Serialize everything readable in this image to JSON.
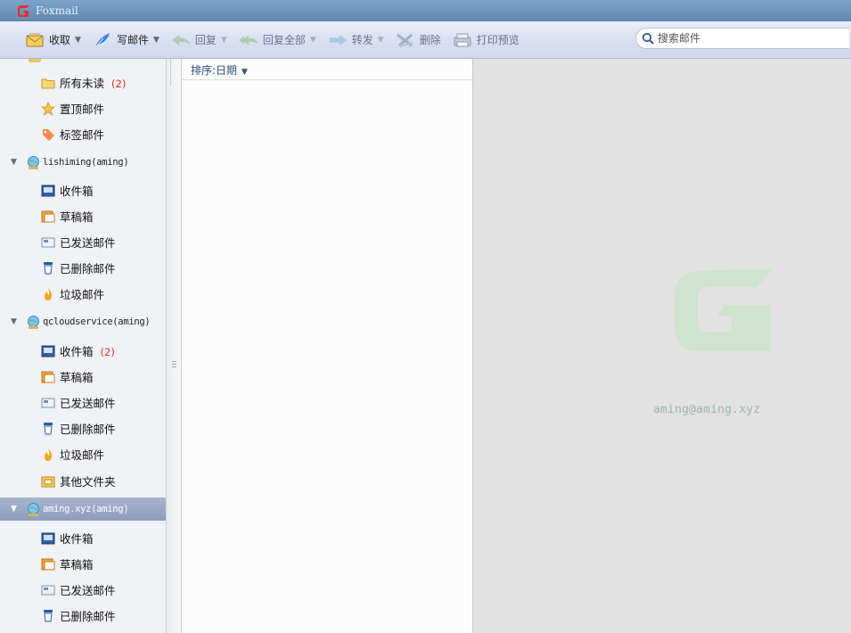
{
  "window": {
    "title": "Foxmail",
    "accent_color": "#5f87b0"
  },
  "toolbar": {
    "receive": {
      "label": "收取",
      "icon": "envelope-icon"
    },
    "compose": {
      "label": "写邮件",
      "icon": "feather-pen-icon"
    },
    "reply": {
      "label": "回复",
      "icon": "reply-arrow-icon"
    },
    "reply_all": {
      "label": "回复全部",
      "icon": "reply-all-arrow-icon"
    },
    "forward": {
      "label": "转发",
      "icon": "forward-arrow-icon"
    },
    "delete": {
      "label": "删除",
      "icon": "delete-x-icon"
    },
    "print_preview": {
      "label": "打印预览",
      "icon": "printer-icon"
    }
  },
  "search": {
    "placeholder": "搜索邮件"
  },
  "sidebar": {
    "top_folders": [
      {
        "label": "所有未读",
        "count": "(2)",
        "icon": "folder-icon"
      },
      {
        "label": "置顶邮件",
        "icon": "star-icon"
      },
      {
        "label": "标签邮件",
        "icon": "tag-icon"
      }
    ],
    "accounts": [
      {
        "name": "lishiming(aming)",
        "folders": [
          {
            "label": "收件箱",
            "icon": "inbox-icon"
          },
          {
            "label": "草稿箱",
            "icon": "drafts-icon"
          },
          {
            "label": "已发送邮件",
            "icon": "sent-icon"
          },
          {
            "label": "已删除邮件",
            "icon": "trash-icon"
          },
          {
            "label": "垃圾邮件",
            "icon": "junk-flame-icon"
          }
        ]
      },
      {
        "name": "qcloudservice(aming)",
        "folders": [
          {
            "label": "收件箱",
            "count": "(2)",
            "icon": "inbox-icon"
          },
          {
            "label": "草稿箱",
            "icon": "drafts-icon"
          },
          {
            "label": "已发送邮件",
            "icon": "sent-icon"
          },
          {
            "label": "已删除邮件",
            "icon": "trash-icon"
          },
          {
            "label": "垃圾邮件",
            "icon": "junk-flame-icon"
          },
          {
            "label": "其他文件夹",
            "icon": "other-folder-icon"
          }
        ]
      },
      {
        "name": "aming.xyz(aming)",
        "selected": true,
        "folders": [
          {
            "label": "收件箱",
            "icon": "inbox-icon"
          },
          {
            "label": "草稿箱",
            "icon": "drafts-icon"
          },
          {
            "label": "已发送邮件",
            "icon": "sent-icon"
          },
          {
            "label": "已删除邮件",
            "icon": "trash-icon"
          }
        ]
      }
    ]
  },
  "mail_list": {
    "sort_label": "排序:日期"
  },
  "preview": {
    "account_email": "aming@aming.xyz",
    "logo_color": "#cfe3cf"
  }
}
